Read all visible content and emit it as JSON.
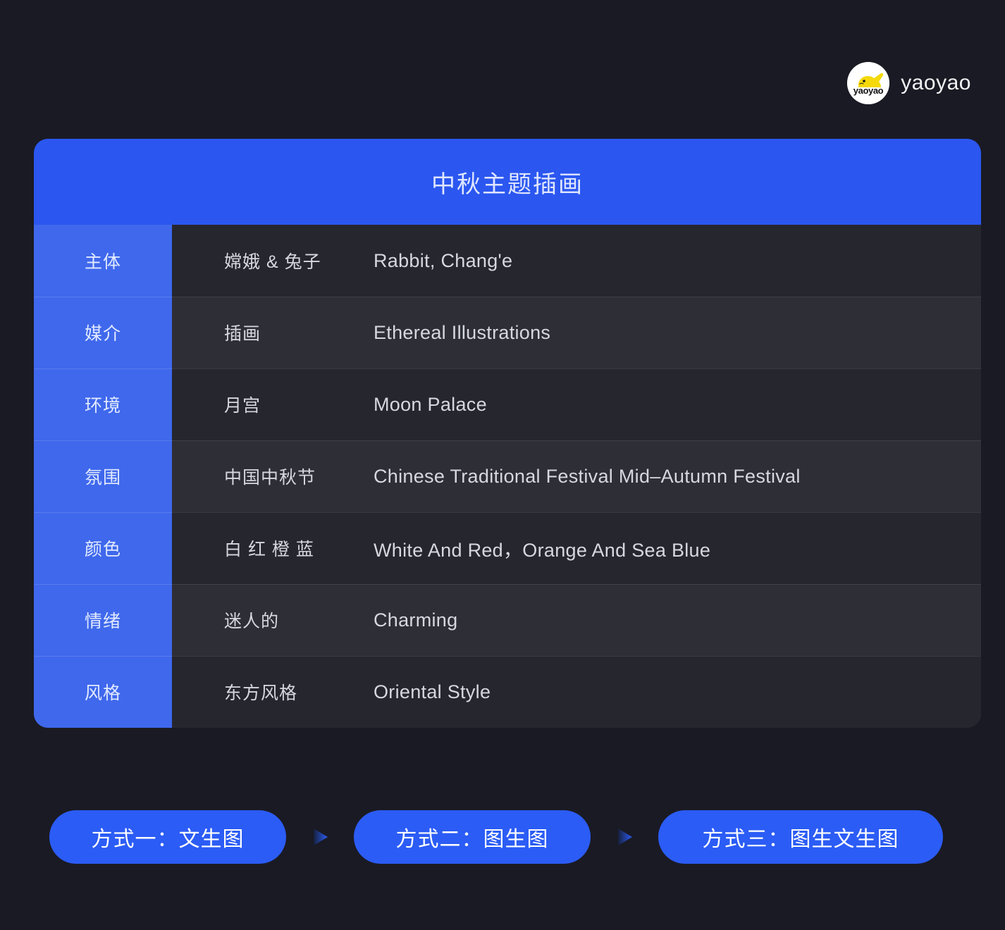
{
  "brand": {
    "name": "yaoyao",
    "logo_icon": "rabbit-logo-icon",
    "logo_text": "yaoyao",
    "circle_color": "#ffffff",
    "rabbit_color": "#f5d90a"
  },
  "table": {
    "title": "中秋主题插画",
    "header_bg": "#2b57f0",
    "label_bg": "#3f68ec",
    "row_bg_odd": "#2e2e36",
    "row_bg_even": "#26262f",
    "rows": [
      {
        "label": "主体",
        "cn": "嫦娥 & 兔子",
        "en": "Rabbit, Chang'e"
      },
      {
        "label": "媒介",
        "cn": "插画",
        "en": "Ethereal Illustrations"
      },
      {
        "label": "环境",
        "cn": "月宫",
        "en": "Moon Palace"
      },
      {
        "label": "氛围",
        "cn": "中国中秋节",
        "en": "Chinese Traditional Festival Mid–Autumn Festival"
      },
      {
        "label": "颜色",
        "cn": "白 红 橙 蓝",
        "en": "White And Red，Orange And Sea Blue"
      },
      {
        "label": "情绪",
        "cn": "迷人的",
        "en": "Charming"
      },
      {
        "label": "风格",
        "cn": "东方风格",
        "en": "Oriental Style"
      }
    ]
  },
  "flow": {
    "steps": [
      {
        "label": "方式一：文生图"
      },
      {
        "label": "方式二：图生图"
      },
      {
        "label": "方式三：图生文生图"
      }
    ],
    "arrow_icon": "triangle-right-icon",
    "pill_color": "#2b5cf5",
    "arrow_color": "#2b5cf5"
  },
  "page": {
    "background": "#1a1a24"
  }
}
